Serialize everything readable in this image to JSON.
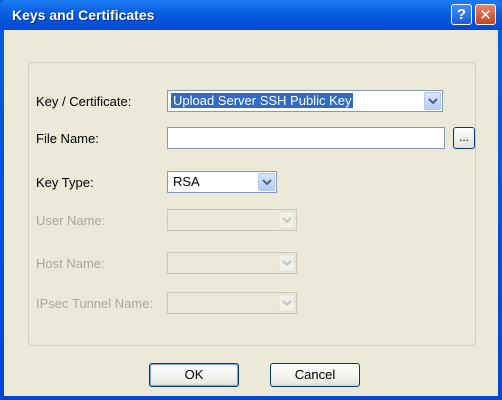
{
  "window": {
    "title": "Keys and Certificates",
    "help_glyph": "?",
    "close_glyph": "✕"
  },
  "form": {
    "key_certificate": {
      "label": "Key / Certificate:",
      "value": "Upload Server SSH Public Key"
    },
    "file_name": {
      "label": "File Name:",
      "value": "",
      "browse_label": "..."
    },
    "key_type": {
      "label": "Key Type:",
      "value": "RSA"
    },
    "user_name": {
      "label": "User Name:",
      "value": ""
    },
    "host_name": {
      "label": "Host Name:",
      "value": ""
    },
    "ipsec_tunnel_name": {
      "label": "IPsec Tunnel Name:",
      "value": ""
    }
  },
  "buttons": {
    "ok_label": "OK",
    "cancel_label": "Cancel"
  },
  "colors": {
    "titlebar": "#0a5fe0",
    "dialog_face": "#ece9d8",
    "selection": "#316ac5",
    "disabled_text": "#aca899"
  }
}
